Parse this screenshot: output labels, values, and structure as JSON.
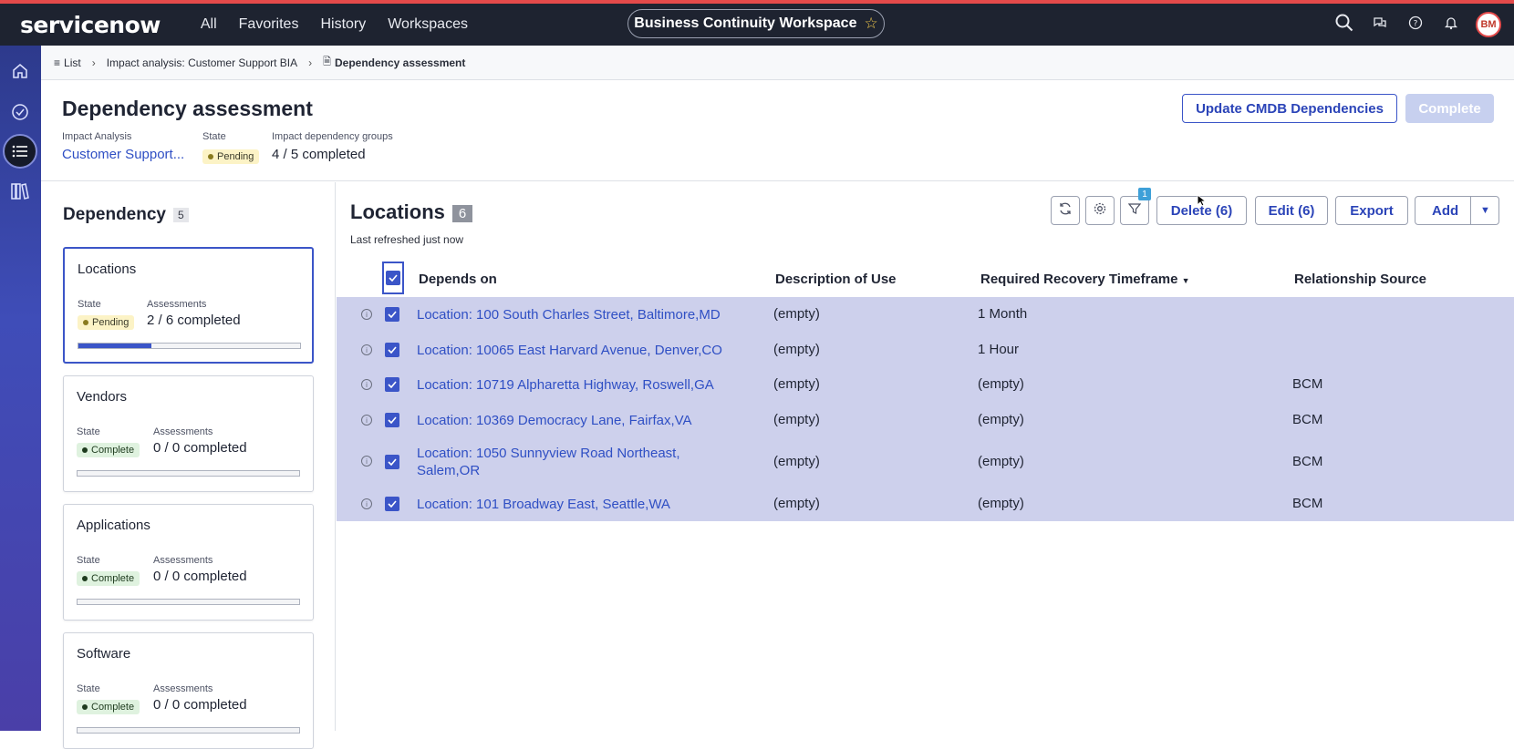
{
  "topbar": {
    "logo": "servicenow",
    "nav": [
      "All",
      "Favorites",
      "History",
      "Workspaces"
    ],
    "workspace": "Business Continuity Workspace",
    "avatar_initials": "BM",
    "icons": [
      "search-icon",
      "chat-icon",
      "help-icon",
      "bell-icon"
    ]
  },
  "breadcrumb": {
    "list": "List",
    "parent": "Impact analysis: Customer Support BIA",
    "current": "Dependency assessment"
  },
  "header": {
    "title": "Dependency assessment",
    "impact_analysis_label": "Impact Analysis",
    "impact_analysis_value": "Customer Support...",
    "state_label": "State",
    "state_value": "Pending",
    "groups_label": "Impact dependency groups",
    "groups_value": "4 / 5 completed",
    "update_button": "Update CMDB Dependencies",
    "complete_button": "Complete"
  },
  "dependency_panel": {
    "title": "Dependency",
    "count": "5",
    "state_label": "State",
    "assessments_label": "Assessments",
    "cards": [
      {
        "name": "Locations",
        "state": "Pending",
        "assessments": "2 / 6 completed",
        "progress": 0.33
      },
      {
        "name": "Vendors",
        "state": "Complete",
        "assessments": "0 / 0 completed",
        "progress": 0
      },
      {
        "name": "Applications",
        "state": "Complete",
        "assessments": "0 / 0 completed",
        "progress": 0
      },
      {
        "name": "Software",
        "state": "Complete",
        "assessments": "0 / 0 completed",
        "progress": 0
      }
    ]
  },
  "list": {
    "title": "Locations",
    "count": "6",
    "refreshed": "Last refreshed just now",
    "filter_count": "1",
    "buttons": {
      "delete": "Delete (6)",
      "edit": "Edit (6)",
      "export": "Export",
      "add": "Add"
    },
    "columns": [
      "Depends on",
      "Description of Use",
      "Required Recovery Timeframe",
      "Relationship Source"
    ],
    "rows": [
      {
        "depends_on": "Location: 100 South Charles Street, Baltimore,MD",
        "description": "(empty)",
        "timeframe": "1 Month",
        "source": ""
      },
      {
        "depends_on": "Location: 10065 East Harvard Avenue, Denver,CO",
        "description": "(empty)",
        "timeframe": "1 Hour",
        "source": ""
      },
      {
        "depends_on": "Location: 10719 Alpharetta Highway, Roswell,GA",
        "description": "(empty)",
        "timeframe": "(empty)",
        "source": "BCM"
      },
      {
        "depends_on": "Location: 10369 Democracy Lane, Fairfax,VA",
        "description": "(empty)",
        "timeframe": "(empty)",
        "source": "BCM"
      },
      {
        "depends_on": "Location: 1050 Sunnyview Road Northeast,",
        "depends_on_line2": "Salem,OR",
        "description": "(empty)",
        "timeframe": "(empty)",
        "source": "BCM"
      },
      {
        "depends_on": "Location: 101 Broadway East, Seattle,WA",
        "description": "(empty)",
        "timeframe": "(empty)",
        "source": "BCM"
      }
    ]
  },
  "colors": {
    "accent": "#3b55c8",
    "topbar": "#1e2330",
    "row_selected": "#cdd0ec",
    "link": "#2f4fc4"
  }
}
